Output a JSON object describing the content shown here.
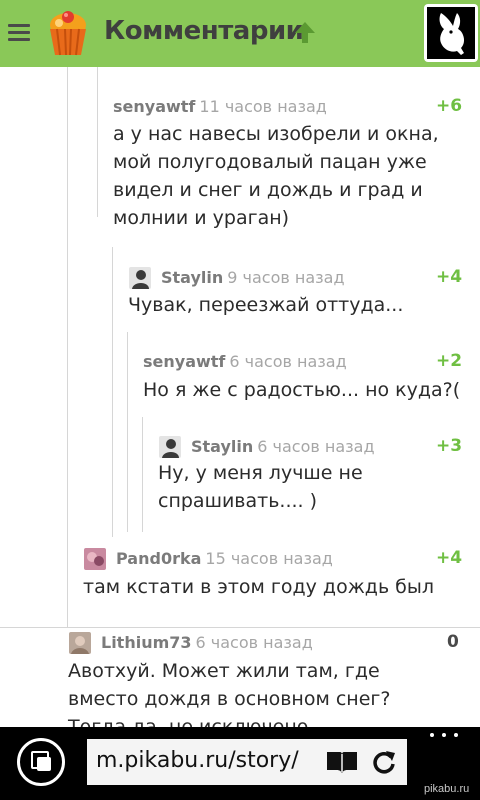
{
  "header": {
    "title": "Комментарии",
    "accent_color": "#8ac858"
  },
  "comments": [
    {
      "author": "senyawtf",
      "time": "11 часов назад",
      "rating": "+6",
      "text": "а у нас навесы изобрели и окна, мой полугодовалый пацан уже видел и снег и дождь и град и молнии и ураган)",
      "avatar": "none"
    },
    {
      "author": "Staylin",
      "time": "9 часов назад",
      "rating": "+4",
      "text": "Чувак, переезжай оттуда...",
      "avatar": "user-avatar"
    },
    {
      "author": "senyawtf",
      "time": "6 часов назад",
      "rating": "+2",
      "text": "Но я же с радостью... но куда?(",
      "avatar": "none"
    },
    {
      "author": "Staylin",
      "time": "6 часов назад",
      "rating": "+3",
      "text": "Ну, у меня лучше не спрашивать.... )",
      "avatar": "user-avatar"
    },
    {
      "author": "Pand0rka",
      "time": "15 часов назад",
      "rating": "+4",
      "text": "там кстати в этом году дождь был",
      "avatar": "user-avatar"
    },
    {
      "author": "Lithium73",
      "time": "6 часов назад",
      "rating": "0",
      "text": "Авотхуй. Может жили там, где вместо дождя в основном снег? Тогда да, не исключено",
      "avatar": "user-avatar"
    }
  ],
  "browser": {
    "url": "m.pikabu.ru/story/",
    "watermark": "pikabu.ru"
  },
  "colors": {
    "positive_rating": "#6fbf42",
    "author": "#7b7b7b",
    "time": "#a6a6a6",
    "thread_line": "#d6d6d6"
  },
  "icons": [
    "hamburger-icon",
    "pikabu-logo",
    "arrow-up-icon",
    "user-avatar",
    "tabs-icon",
    "reader-icon",
    "refresh-icon",
    "more-icon"
  ]
}
